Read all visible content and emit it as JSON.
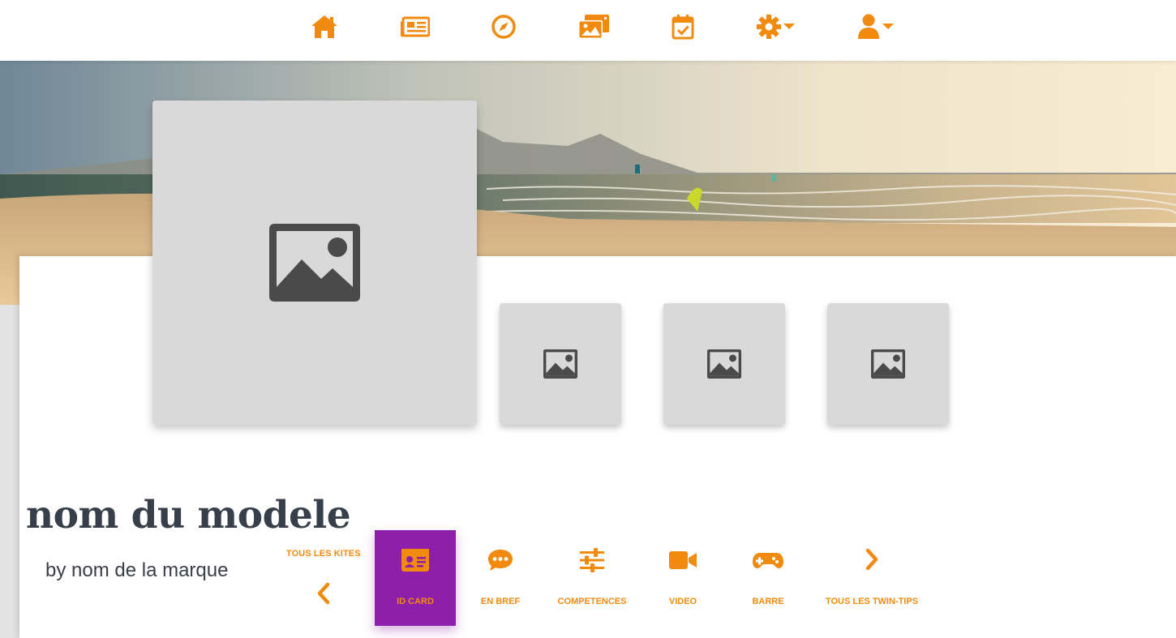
{
  "colors": {
    "accent": "#f28a0f",
    "active_tab": "#8e1faa",
    "title_text": "#363f4a",
    "placeholder_bg": "#d9d9d9",
    "placeholder_icon": "#4a4a4a"
  },
  "nav": {
    "items": [
      {
        "icon": "home-icon"
      },
      {
        "icon": "newspaper-icon"
      },
      {
        "icon": "compass-icon"
      },
      {
        "icon": "photos-icon"
      },
      {
        "icon": "calendar-check-icon"
      },
      {
        "icon": "gear-dropdown-icon"
      },
      {
        "icon": "user-dropdown-icon"
      }
    ]
  },
  "gallery": {
    "main_icon": "image-placeholder-icon",
    "thumbs": 3
  },
  "model": {
    "title": "nom du modele",
    "brand": "by nom de la marque"
  },
  "tabs": {
    "prev_label": "TOUS LES KITES",
    "items": [
      {
        "label": "ID CARD",
        "icon": "id-card-icon",
        "active": true
      },
      {
        "label": "EN BREF",
        "icon": "comment-dots-icon",
        "active": false
      },
      {
        "label": "COMPETENCES",
        "icon": "sliders-icon",
        "active": false
      },
      {
        "label": "VIDEO",
        "icon": "video-camera-icon",
        "active": false
      },
      {
        "label": "BARRE",
        "icon": "gamepad-icon",
        "active": false
      }
    ],
    "next_label": "TOUS LES TWIN-TIPS"
  }
}
